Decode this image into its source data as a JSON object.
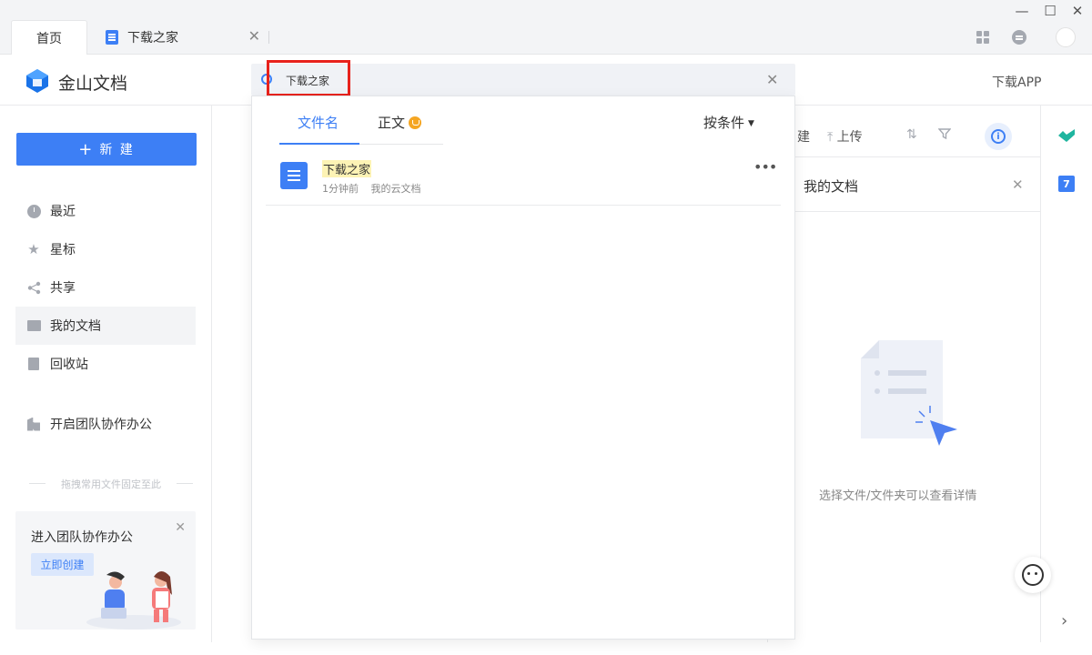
{
  "tabs": [
    {
      "label": "首页"
    },
    {
      "label": "下载之家"
    }
  ],
  "header": {
    "app_name": "金山文档",
    "download_app": "下载APP"
  },
  "search": {
    "value": "下载之家",
    "placeholder": ""
  },
  "search_popup": {
    "tab_filename": "文件名",
    "tab_body": "正文",
    "filter_label": "按条件",
    "results": [
      {
        "name": "下载之家",
        "time": "1分钟前",
        "location": "我的云文档"
      }
    ]
  },
  "sidebar": {
    "new_button": "新 建",
    "items": [
      {
        "label": "最近"
      },
      {
        "label": "星标"
      },
      {
        "label": "共享"
      },
      {
        "label": "我的文档"
      },
      {
        "label": "回收站"
      },
      {
        "label": "开启团队协作办公"
      }
    ],
    "pin_hint": "拖拽常用文件固定至此",
    "team_card": {
      "title": "进入团队协作办公",
      "button": "立即创建"
    }
  },
  "right_panel": {
    "tool_new": "建",
    "tool_upload": "上传",
    "title": "我的文档",
    "empty_text": "选择文件/文件夹可以查看详情"
  },
  "colors": {
    "accent": "#3d7ff5",
    "highlight_border": "#e8221c",
    "match_highlight": "#fdf3b5"
  }
}
